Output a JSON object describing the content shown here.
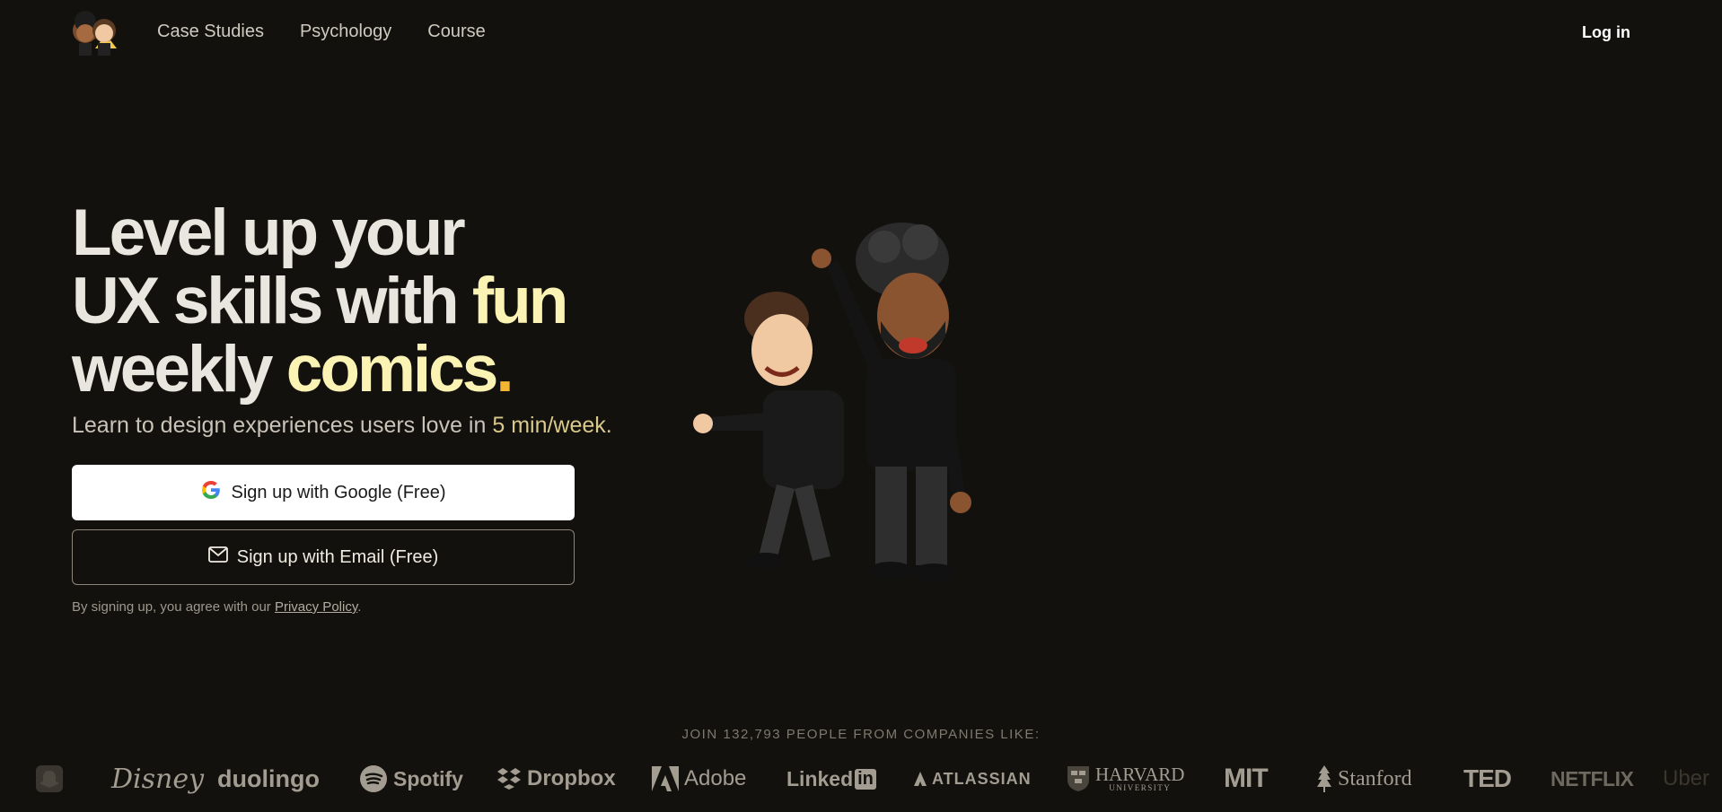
{
  "nav": {
    "links": [
      "Case Studies",
      "Psychology",
      "Course"
    ],
    "login": "Log in"
  },
  "hero": {
    "line1": "Level up your",
    "line2_a": "UX skills with ",
    "line2_b": "fun",
    "line3_a": "weekly ",
    "line3_b": "comics",
    "line3_dot": ".",
    "subtitle_a": "Learn to design experiences users love in ",
    "subtitle_b": "5 min/week."
  },
  "signup": {
    "google": "Sign up with Google (Free)",
    "email": "Sign up with Email (Free)",
    "terms_prefix": "By signing up, you agree with our ",
    "privacy": "Privacy Policy",
    "terms_suffix": "."
  },
  "social_proof": {
    "heading": "JOIN 132,793 PEOPLE FROM COMPANIES LIKE:",
    "companies": [
      "Disney",
      "duolingo",
      "Spotify",
      "Dropbox",
      "Adobe",
      "Linked",
      "in",
      "ATLASSIAN",
      "HARVARD",
      "UNIVERSITY",
      "MIT",
      "Stanford",
      "TED",
      "NETFLIX",
      "Uber"
    ]
  },
  "colors": {
    "background": "#13110d",
    "accent_yellow": "#fbf3b4",
    "dot_orange": "#f3b533"
  }
}
